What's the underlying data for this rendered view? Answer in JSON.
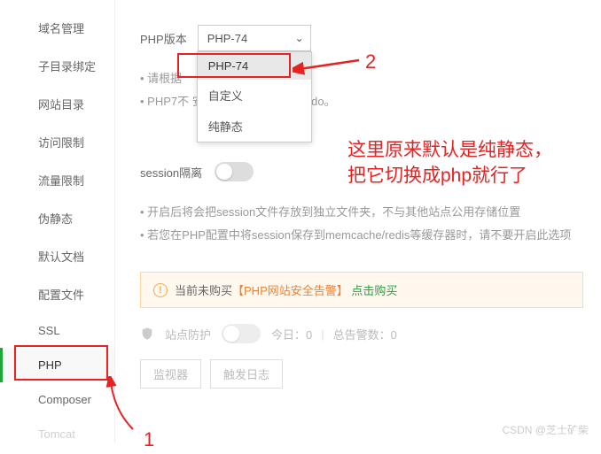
{
  "sidebar": {
    "items": [
      {
        "label": "域名管理"
      },
      {
        "label": "子目录绑定"
      },
      {
        "label": "网站目录"
      },
      {
        "label": "访问限制"
      },
      {
        "label": "流量限制"
      },
      {
        "label": "伪静态"
      },
      {
        "label": "默认文档"
      },
      {
        "label": "配置文件"
      },
      {
        "label": "SSL"
      },
      {
        "label": "PHP",
        "active": true
      },
      {
        "label": "Composer"
      },
      {
        "label": "Tomcat"
      }
    ]
  },
  "php": {
    "label": "PHP版本",
    "selected": "PHP-74",
    "options": [
      "PHP-74",
      "自定义",
      "纯静态"
    ],
    "hints": [
      "请根据",
      "PHP7不                                      安装mysqli以及mysql-pdo。"
    ]
  },
  "session": {
    "label": "session隔离",
    "hints": [
      "开启后将会把session文件存放到独立文件夹，不与其他站点公用存储位置",
      "若您在PHP配置中将session保存到memcache/redis等缓存器时，请不要开启此选项"
    ]
  },
  "alert": {
    "prefix": "当前未购买",
    "bracket": "【PHP网站安全告警】",
    "action": "点击购买"
  },
  "protect": {
    "label": "站点防护",
    "today": "今日：0",
    "total": "总告警数：0"
  },
  "buttons": {
    "monitor": "监视器",
    "trigger": "触发日志"
  },
  "annotations": {
    "n1": "1",
    "n2": "2",
    "note": "这里原来默认是纯静态，\n把它切换成php就行了"
  },
  "watermark": "CSDN @芝士矿柴"
}
